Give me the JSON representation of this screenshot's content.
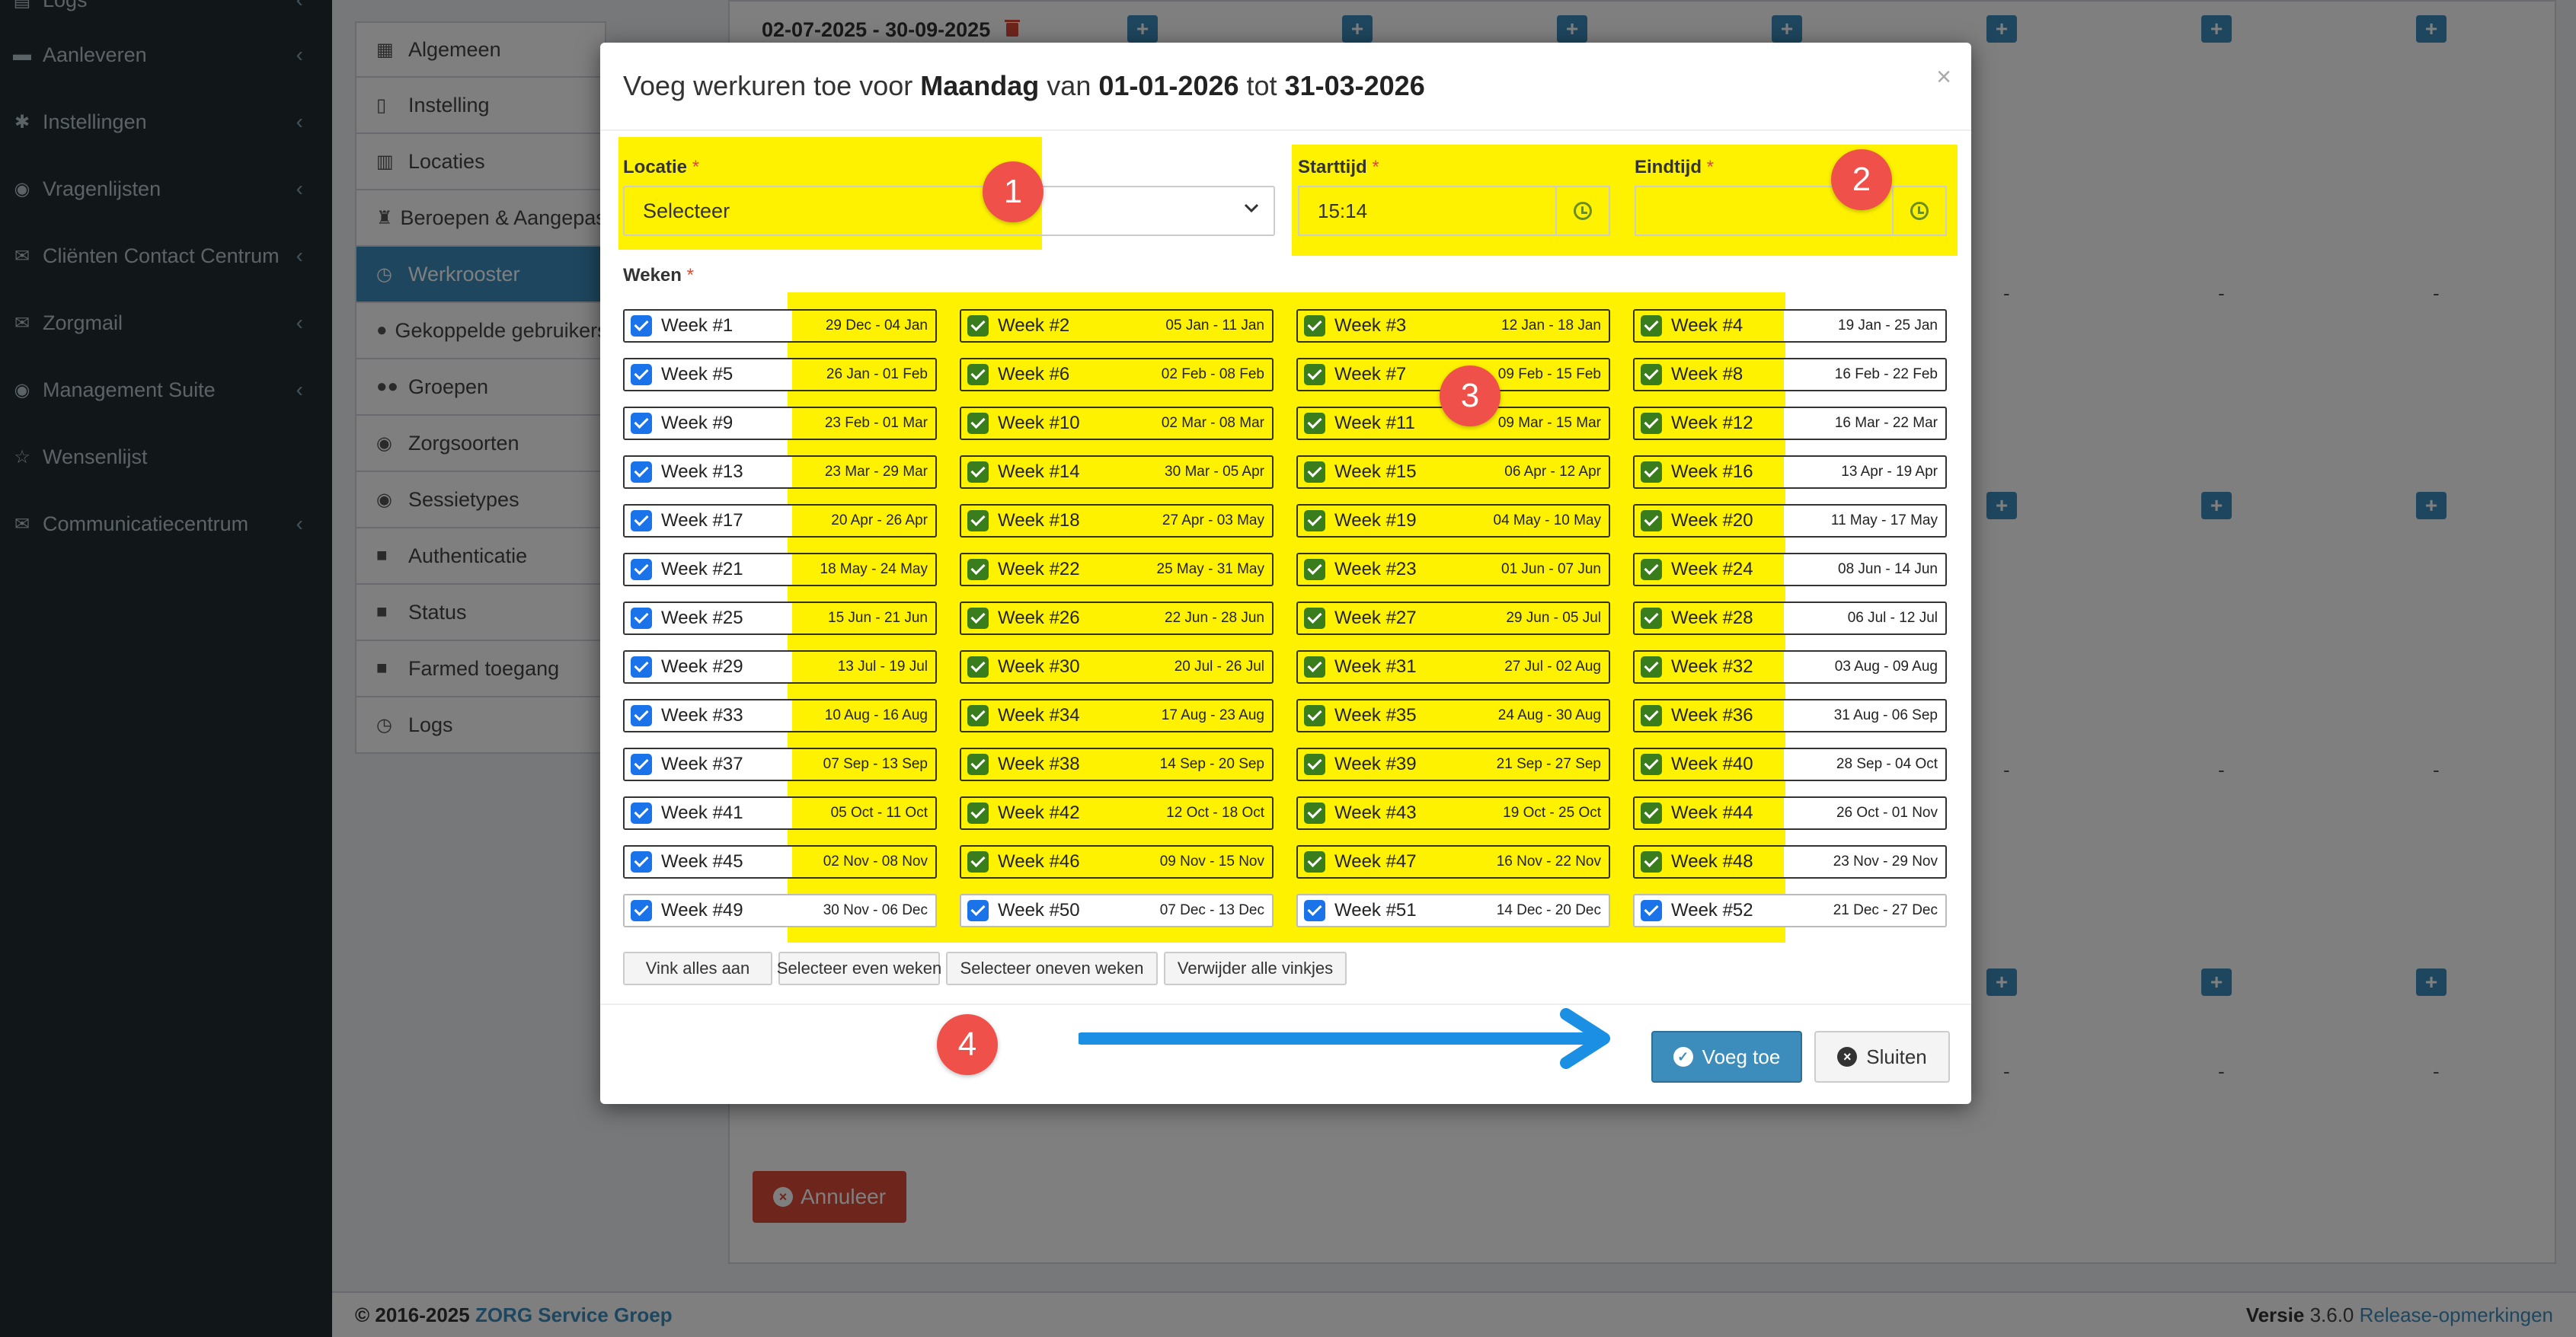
{
  "sidebar": {
    "items": [
      {
        "label": "Logs",
        "icon": "folder-icon"
      },
      {
        "label": "Aanleveren",
        "icon": "truck-icon"
      },
      {
        "label": "Instellingen",
        "icon": "gear-icon"
      },
      {
        "label": "Vragenlijsten",
        "icon": "globe-icon"
      },
      {
        "label": "Cliënten Contact Centrum",
        "icon": "envelope-icon"
      },
      {
        "label": "Zorgmail",
        "icon": "envelope-icon"
      },
      {
        "label": "Management Suite",
        "icon": "globe-icon"
      },
      {
        "label": "Wensenlijst",
        "icon": "star-icon"
      },
      {
        "label": "Communicatiecentrum",
        "icon": "envelope-icon"
      }
    ]
  },
  "submenu": {
    "items": [
      {
        "label": "Algemeen",
        "icon": "table-icon"
      },
      {
        "label": "Instelling",
        "icon": "file-icon"
      },
      {
        "label": "Locaties",
        "icon": "map-icon"
      },
      {
        "label": "Beroepen & Aangepast",
        "icon": "user-tie-icon"
      },
      {
        "label": "Werkrooster",
        "icon": "clock-icon"
      },
      {
        "label": "Gekoppelde gebruikers",
        "icon": "user-icon"
      },
      {
        "label": "Groepen",
        "icon": "users-icon"
      },
      {
        "label": "Zorgsoorten",
        "icon": "globe-icon"
      },
      {
        "label": "Sessietypes",
        "icon": "globe-icon"
      },
      {
        "label": "Authenticatie",
        "icon": "lock-icon"
      },
      {
        "label": "Status",
        "icon": "lock-icon"
      },
      {
        "label": "Farmed toegang",
        "icon": "lock-icon"
      },
      {
        "label": "Logs",
        "icon": "clock-icon"
      }
    ],
    "active_index": 4
  },
  "schedule": {
    "range_label": "02-07-2025 - 30-09-2025",
    "dash": "-",
    "cancel_label": "Annuleer"
  },
  "footer": {
    "copyright_prefix": "© 2016-2025",
    "company": "ZORG Service Groep",
    "version_label": "Versie",
    "version": "3.6.0",
    "release_notes": "Release-opmerkingen"
  },
  "modal": {
    "title_prefix": "Voeg werkuren toe voor",
    "day": "Maandag",
    "title_mid": "van",
    "date_from": "01-01-2026",
    "title_to": "tot",
    "date_to": "31-03-2026",
    "close_symbol": "×",
    "location_label": "Locatie",
    "location_value": "Selecteer",
    "start_label": "Starttijd",
    "start_value": "15:14",
    "end_label": "Eindtijd",
    "end_value": "",
    "required_mark": "*",
    "weeks_label": "Weken",
    "weeks": [
      {
        "label": "Week #1",
        "dates": "29 Dec - 04 Jan"
      },
      {
        "label": "Week #2",
        "dates": "05 Jan - 11 Jan"
      },
      {
        "label": "Week #3",
        "dates": "12 Jan - 18 Jan"
      },
      {
        "label": "Week #4",
        "dates": "19 Jan - 25 Jan"
      },
      {
        "label": "Week #5",
        "dates": "26 Jan - 01 Feb"
      },
      {
        "label": "Week #6",
        "dates": "02 Feb - 08 Feb"
      },
      {
        "label": "Week #7",
        "dates": "09 Feb - 15 Feb"
      },
      {
        "label": "Week #8",
        "dates": "16 Feb - 22 Feb"
      },
      {
        "label": "Week #9",
        "dates": "23 Feb - 01 Mar"
      },
      {
        "label": "Week #10",
        "dates": "02 Mar - 08 Mar"
      },
      {
        "label": "Week #11",
        "dates": "09 Mar - 15 Mar"
      },
      {
        "label": "Week #12",
        "dates": "16 Mar - 22 Mar"
      },
      {
        "label": "Week #13",
        "dates": "23 Mar - 29 Mar"
      },
      {
        "label": "Week #14",
        "dates": "30 Mar - 05 Apr"
      },
      {
        "label": "Week #15",
        "dates": "06 Apr - 12 Apr"
      },
      {
        "label": "Week #16",
        "dates": "13 Apr - 19 Apr"
      },
      {
        "label": "Week #17",
        "dates": "20 Apr - 26 Apr"
      },
      {
        "label": "Week #18",
        "dates": "27 Apr - 03 May"
      },
      {
        "label": "Week #19",
        "dates": "04 May - 10 May"
      },
      {
        "label": "Week #20",
        "dates": "11 May - 17 May"
      },
      {
        "label": "Week #21",
        "dates": "18 May - 24 May"
      },
      {
        "label": "Week #22",
        "dates": "25 May - 31 May"
      },
      {
        "label": "Week #23",
        "dates": "01 Jun - 07 Jun"
      },
      {
        "label": "Week #24",
        "dates": "08 Jun - 14 Jun"
      },
      {
        "label": "Week #25",
        "dates": "15 Jun - 21 Jun"
      },
      {
        "label": "Week #26",
        "dates": "22 Jun - 28 Jun"
      },
      {
        "label": "Week #27",
        "dates": "29 Jun - 05 Jul"
      },
      {
        "label": "Week #28",
        "dates": "06 Jul - 12 Jul"
      },
      {
        "label": "Week #29",
        "dates": "13 Jul - 19 Jul"
      },
      {
        "label": "Week #30",
        "dates": "20 Jul - 26 Jul"
      },
      {
        "label": "Week #31",
        "dates": "27 Jul - 02 Aug"
      },
      {
        "label": "Week #32",
        "dates": "03 Aug - 09 Aug"
      },
      {
        "label": "Week #33",
        "dates": "10 Aug - 16 Aug"
      },
      {
        "label": "Week #34",
        "dates": "17 Aug - 23 Aug"
      },
      {
        "label": "Week #35",
        "dates": "24 Aug - 30 Aug"
      },
      {
        "label": "Week #36",
        "dates": "31 Aug - 06 Sep"
      },
      {
        "label": "Week #37",
        "dates": "07 Sep - 13 Sep"
      },
      {
        "label": "Week #38",
        "dates": "14 Sep - 20 Sep"
      },
      {
        "label": "Week #39",
        "dates": "21 Sep - 27 Sep"
      },
      {
        "label": "Week #40",
        "dates": "28 Sep - 04 Oct"
      },
      {
        "label": "Week #41",
        "dates": "05 Oct - 11 Oct"
      },
      {
        "label": "Week #42",
        "dates": "12 Oct - 18 Oct"
      },
      {
        "label": "Week #43",
        "dates": "19 Oct - 25 Oct"
      },
      {
        "label": "Week #44",
        "dates": "26 Oct - 01 Nov"
      },
      {
        "label": "Week #45",
        "dates": "02 Nov - 08 Nov"
      },
      {
        "label": "Week #46",
        "dates": "09 Nov - 15 Nov"
      },
      {
        "label": "Week #47",
        "dates": "16 Nov - 22 Nov"
      },
      {
        "label": "Week #48",
        "dates": "23 Nov - 29 Nov"
      },
      {
        "label": "Week #49",
        "dates": "30 Nov - 06 Dec"
      },
      {
        "label": "Week #50",
        "dates": "07 Dec - 13 Dec"
      },
      {
        "label": "Week #51",
        "dates": "14 Dec - 20 Dec"
      },
      {
        "label": "Week #52",
        "dates": "21 Dec - 27 Dec"
      }
    ],
    "bulk_buttons": [
      "Vink alles aan",
      "Selecteer even weken",
      "Selecteer oneven weken",
      "Verwijder alle vinkjes"
    ],
    "add_label": "Voeg toe",
    "close_label": "Sluiten"
  },
  "annotations": [
    "1",
    "2",
    "3",
    "4"
  ],
  "colors": {
    "highlight": "#fff200",
    "primary": "#3c8dbc",
    "danger": "#dd4b39",
    "badge": "#f0504a",
    "arrow": "#1a8fe3"
  }
}
